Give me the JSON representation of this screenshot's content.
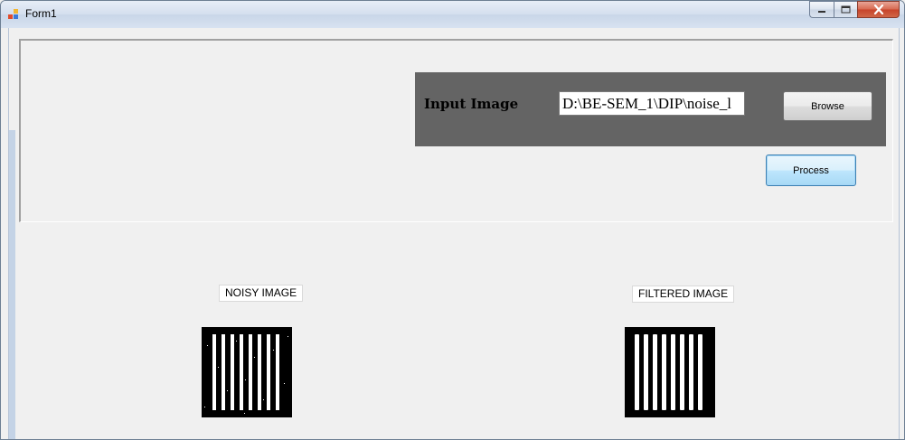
{
  "window": {
    "title": "Form1"
  },
  "input": {
    "label": "Input Image",
    "path_value": "D:\\BE-SEM_1\\DIP\\noise_l",
    "browse_label": "Browse"
  },
  "actions": {
    "process_label": "Process"
  },
  "images": {
    "noisy_label": "NOISY IMAGE",
    "filtered_label": "FILTERED IMAGE"
  },
  "icons": {
    "app": "app-form-icon",
    "minimize": "minimize-icon",
    "maximize": "maximize-icon",
    "close": "close-icon"
  }
}
